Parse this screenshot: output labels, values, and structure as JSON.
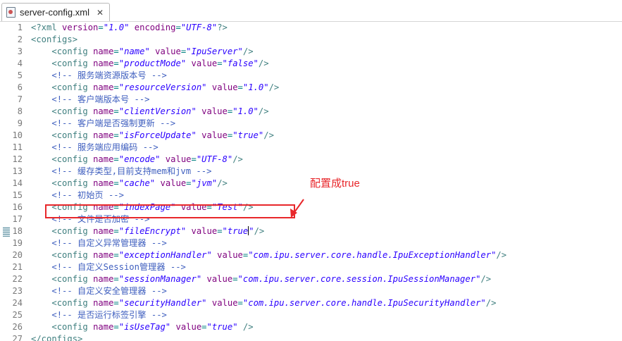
{
  "tab": {
    "title": "server-config.xml"
  },
  "annotation": {
    "callout": "配置成true",
    "color": "#e8272b"
  },
  "lines": [
    {
      "n": "1",
      "tokens": [
        {
          "t": "pi",
          "s": "<?xml "
        },
        {
          "t": "attr",
          "s": "version"
        },
        {
          "t": "punct",
          "s": "="
        },
        {
          "t": "val",
          "s": "\"1.0\""
        },
        {
          "t": "attr",
          "s": " encoding"
        },
        {
          "t": "punct",
          "s": "="
        },
        {
          "t": "val",
          "s": "\"UTF-8\""
        },
        {
          "t": "pi",
          "s": "?>"
        }
      ]
    },
    {
      "n": "2",
      "tokens": [
        {
          "t": "tag",
          "s": "<configs>"
        }
      ]
    },
    {
      "n": "3",
      "tokens": [
        {
          "t": "plain",
          "s": "    "
        },
        {
          "t": "tag",
          "s": "<config "
        },
        {
          "t": "attr",
          "s": "name"
        },
        {
          "t": "punct",
          "s": "="
        },
        {
          "t": "val",
          "s": "\"name\""
        },
        {
          "t": "attr",
          "s": " value"
        },
        {
          "t": "punct",
          "s": "="
        },
        {
          "t": "val",
          "s": "\"IpuServer\""
        },
        {
          "t": "tag",
          "s": "/>"
        }
      ]
    },
    {
      "n": "4",
      "tokens": [
        {
          "t": "plain",
          "s": "    "
        },
        {
          "t": "tag",
          "s": "<config "
        },
        {
          "t": "attr",
          "s": "name"
        },
        {
          "t": "punct",
          "s": "="
        },
        {
          "t": "val",
          "s": "\"productMode\""
        },
        {
          "t": "attr",
          "s": " value"
        },
        {
          "t": "punct",
          "s": "="
        },
        {
          "t": "val",
          "s": "\"false\""
        },
        {
          "t": "tag",
          "s": "/>"
        }
      ]
    },
    {
      "n": "5",
      "tokens": [
        {
          "t": "plain",
          "s": "    "
        },
        {
          "t": "comment",
          "s": "<!-- 服务端资源版本号 -->"
        }
      ]
    },
    {
      "n": "6",
      "tokens": [
        {
          "t": "plain",
          "s": "    "
        },
        {
          "t": "tag",
          "s": "<config "
        },
        {
          "t": "attr",
          "s": "name"
        },
        {
          "t": "punct",
          "s": "="
        },
        {
          "t": "val",
          "s": "\"resourceVersion\""
        },
        {
          "t": "attr",
          "s": " value"
        },
        {
          "t": "punct",
          "s": "="
        },
        {
          "t": "val",
          "s": "\"1.0\""
        },
        {
          "t": "tag",
          "s": "/>"
        }
      ]
    },
    {
      "n": "7",
      "tokens": [
        {
          "t": "plain",
          "s": "    "
        },
        {
          "t": "comment",
          "s": "<!-- 客户端版本号 -->"
        }
      ]
    },
    {
      "n": "8",
      "tokens": [
        {
          "t": "plain",
          "s": "    "
        },
        {
          "t": "tag",
          "s": "<config "
        },
        {
          "t": "attr",
          "s": "name"
        },
        {
          "t": "punct",
          "s": "="
        },
        {
          "t": "val",
          "s": "\"clientVersion\""
        },
        {
          "t": "attr",
          "s": " value"
        },
        {
          "t": "punct",
          "s": "="
        },
        {
          "t": "val",
          "s": "\"1.0\""
        },
        {
          "t": "tag",
          "s": "/>"
        }
      ]
    },
    {
      "n": "9",
      "tokens": [
        {
          "t": "plain",
          "s": "    "
        },
        {
          "t": "comment",
          "s": "<!-- 客户端是否强制更新 -->"
        }
      ]
    },
    {
      "n": "10",
      "tokens": [
        {
          "t": "plain",
          "s": "    "
        },
        {
          "t": "tag",
          "s": "<config "
        },
        {
          "t": "attr",
          "s": "name"
        },
        {
          "t": "punct",
          "s": "="
        },
        {
          "t": "val",
          "s": "\"isForceUpdate\""
        },
        {
          "t": "attr",
          "s": " value"
        },
        {
          "t": "punct",
          "s": "="
        },
        {
          "t": "val",
          "s": "\"true\""
        },
        {
          "t": "tag",
          "s": "/>"
        }
      ]
    },
    {
      "n": "11",
      "tokens": [
        {
          "t": "plain",
          "s": "    "
        },
        {
          "t": "comment",
          "s": "<!-- 服务端应用编码 -->"
        }
      ]
    },
    {
      "n": "12",
      "tokens": [
        {
          "t": "plain",
          "s": "    "
        },
        {
          "t": "tag",
          "s": "<config "
        },
        {
          "t": "attr",
          "s": "name"
        },
        {
          "t": "punct",
          "s": "="
        },
        {
          "t": "val",
          "s": "\"encode\""
        },
        {
          "t": "attr",
          "s": " value"
        },
        {
          "t": "punct",
          "s": "="
        },
        {
          "t": "val",
          "s": "\"UTF-8\""
        },
        {
          "t": "tag",
          "s": "/>"
        }
      ]
    },
    {
      "n": "13",
      "tokens": [
        {
          "t": "plain",
          "s": "    "
        },
        {
          "t": "comment",
          "s": "<!-- 缓存类型,目前支持mem和jvm -->"
        }
      ]
    },
    {
      "n": "14",
      "tokens": [
        {
          "t": "plain",
          "s": "    "
        },
        {
          "t": "tag",
          "s": "<config "
        },
        {
          "t": "attr",
          "s": "name"
        },
        {
          "t": "punct",
          "s": "="
        },
        {
          "t": "val",
          "s": "\"cache\""
        },
        {
          "t": "attr",
          "s": " value"
        },
        {
          "t": "punct",
          "s": "="
        },
        {
          "t": "val",
          "s": "\"jvm\""
        },
        {
          "t": "tag",
          "s": "/>"
        }
      ]
    },
    {
      "n": "15",
      "tokens": [
        {
          "t": "plain",
          "s": "    "
        },
        {
          "t": "comment",
          "s": "<!-- 初始页 -->"
        }
      ]
    },
    {
      "n": "16",
      "tokens": [
        {
          "t": "plain",
          "s": "    "
        },
        {
          "t": "tag",
          "s": "<config "
        },
        {
          "t": "attr",
          "s": "name"
        },
        {
          "t": "punct",
          "s": "="
        },
        {
          "t": "val",
          "s": "\"indexPage\""
        },
        {
          "t": "attr",
          "s": " value"
        },
        {
          "t": "punct",
          "s": "="
        },
        {
          "t": "val",
          "s": "\"Test\""
        },
        {
          "t": "tag",
          "s": "/>"
        }
      ]
    },
    {
      "n": "17",
      "tokens": [
        {
          "t": "plain",
          "s": "    "
        },
        {
          "t": "comment",
          "s": "<!-- 文件是否加密 -->"
        }
      ]
    },
    {
      "n": "18",
      "marker": true,
      "tokens": [
        {
          "t": "plain",
          "s": "    "
        },
        {
          "t": "tag",
          "s": "<config "
        },
        {
          "t": "attr",
          "s": "name"
        },
        {
          "t": "punct",
          "s": "="
        },
        {
          "t": "val",
          "s": "\"fileEncrypt\""
        },
        {
          "t": "attr",
          "s": " value"
        },
        {
          "t": "punct",
          "s": "="
        },
        {
          "t": "val",
          "s": "\"true"
        },
        {
          "t": "caret",
          "s": ""
        },
        {
          "t": "val",
          "s": "\""
        },
        {
          "t": "tag",
          "s": "/>"
        }
      ]
    },
    {
      "n": "19",
      "tokens": [
        {
          "t": "plain",
          "s": "    "
        },
        {
          "t": "comment",
          "s": "<!-- 自定义异常管理器 -->"
        }
      ]
    },
    {
      "n": "20",
      "tokens": [
        {
          "t": "plain",
          "s": "    "
        },
        {
          "t": "tag",
          "s": "<config "
        },
        {
          "t": "attr",
          "s": "name"
        },
        {
          "t": "punct",
          "s": "="
        },
        {
          "t": "val",
          "s": "\"exceptionHandler\""
        },
        {
          "t": "attr",
          "s": " value"
        },
        {
          "t": "punct",
          "s": "="
        },
        {
          "t": "val",
          "s": "\"com.ipu.server.core.handle.IpuExceptionHandler\""
        },
        {
          "t": "tag",
          "s": "/>"
        }
      ]
    },
    {
      "n": "21",
      "tokens": [
        {
          "t": "plain",
          "s": "    "
        },
        {
          "t": "comment",
          "s": "<!-- 自定义Session管理器 -->"
        }
      ]
    },
    {
      "n": "22",
      "tokens": [
        {
          "t": "plain",
          "s": "    "
        },
        {
          "t": "tag",
          "s": "<config "
        },
        {
          "t": "attr",
          "s": "name"
        },
        {
          "t": "punct",
          "s": "="
        },
        {
          "t": "val",
          "s": "\"sessionManager\""
        },
        {
          "t": "attr",
          "s": " value"
        },
        {
          "t": "punct",
          "s": "="
        },
        {
          "t": "val",
          "s": "\"com.ipu.server.core.session.IpuSessionManager\""
        },
        {
          "t": "tag",
          "s": "/>"
        }
      ]
    },
    {
      "n": "23",
      "tokens": [
        {
          "t": "plain",
          "s": "    "
        },
        {
          "t": "comment",
          "s": "<!-- 自定义安全管理器 -->"
        }
      ]
    },
    {
      "n": "24",
      "tokens": [
        {
          "t": "plain",
          "s": "    "
        },
        {
          "t": "tag",
          "s": "<config "
        },
        {
          "t": "attr",
          "s": "name"
        },
        {
          "t": "punct",
          "s": "="
        },
        {
          "t": "val",
          "s": "\"securityHandler\""
        },
        {
          "t": "attr",
          "s": " value"
        },
        {
          "t": "punct",
          "s": "="
        },
        {
          "t": "val",
          "s": "\"com.ipu.server.core.handle.IpuSecurityHandler\""
        },
        {
          "t": "tag",
          "s": "/>"
        }
      ]
    },
    {
      "n": "25",
      "tokens": [
        {
          "t": "plain",
          "s": "    "
        },
        {
          "t": "comment",
          "s": "<!-- 是否运行标签引擎 -->"
        }
      ]
    },
    {
      "n": "26",
      "tokens": [
        {
          "t": "plain",
          "s": "    "
        },
        {
          "t": "tag",
          "s": "<config "
        },
        {
          "t": "attr",
          "s": "name"
        },
        {
          "t": "punct",
          "s": "="
        },
        {
          "t": "val",
          "s": "\"isUseTag\""
        },
        {
          "t": "attr",
          "s": " value"
        },
        {
          "t": "punct",
          "s": "="
        },
        {
          "t": "val",
          "s": "\"true\""
        },
        {
          "t": "tag",
          "s": " />"
        }
      ]
    },
    {
      "n": "27",
      "tokens": [
        {
          "t": "tag",
          "s": "</configs>"
        }
      ]
    }
  ]
}
